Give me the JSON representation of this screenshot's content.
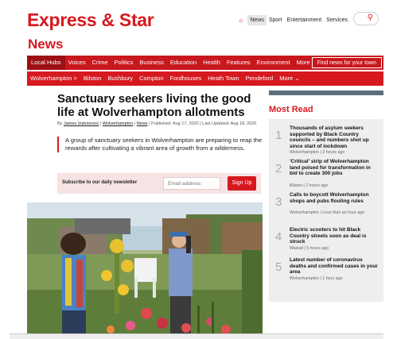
{
  "logo": "Express & Star",
  "topnav": {
    "items": [
      "News",
      "Sport",
      "Entertainment",
      "Services"
    ],
    "active": "News"
  },
  "section_title": "News",
  "rednav": {
    "items": [
      "Local Hubs",
      "Voices",
      "Crime",
      "Politics",
      "Business",
      "Education",
      "Health",
      "Features",
      "Environment",
      "More ⌄"
    ],
    "find_button": "Find news for your town"
  },
  "subnav": {
    "items": [
      "Wolverhampton >",
      "Bilston",
      "Bushbury",
      "Compton",
      "Fordhouses",
      "Heath Town",
      "Pendeford",
      "More ⌄"
    ]
  },
  "article": {
    "headline": "Sanctuary seekers living the good life at Wolverhampton allotments",
    "byline_prefix": "By ",
    "author": "James Vukmirovic",
    "sep1": " | ",
    "place": "Wolverhampton",
    "sep2": " | ",
    "category": "News",
    "dates": " | Published: Aug 17, 2020 | Last Updated: Aug 18, 2020",
    "standfirst": "A group of sanctuary seekers in Wolverhampton are preparing to reap the rewards after cultivating a vibrant area of growth from a wilderness."
  },
  "newsletter": {
    "label": "Subscribe to our daily newsletter",
    "placeholder": "Email address:",
    "button": "Sign Up"
  },
  "most_read": {
    "title": "Most Read",
    "items": [
      {
        "num": "1",
        "headline": "Thousands of asylum seekers supported by Black Country councils – and numbers shot up since start of lockdown",
        "meta": "Wolverhampton | 2 hours ago"
      },
      {
        "num": "2",
        "headline": "'Critical' strip of Wolverhampton land poised for transformation in bid to create 300 jobs",
        "meta": "Bilston | 2 hours ago"
      },
      {
        "num": "3",
        "headline": "Calls to boycott Wolverhampton shops and pubs flouting rules",
        "meta": "Wolverhampton | Less than an hour ago"
      },
      {
        "num": "4",
        "headline": "Electric scooters to hit Black Country streets soon as deal is struck",
        "meta": "Walsall | 5 hours ago"
      },
      {
        "num": "5",
        "headline": "Latest number of coronavirus deaths and confirmed cases in your area",
        "meta": "Wolverhampton | 1 hour ago"
      }
    ]
  },
  "colors": {
    "brand_red": "#d6191f",
    "nav_red": "#c8171d",
    "sidebar_bg": "#eeeeee"
  },
  "icons": [
    "home-icon",
    "search-icon"
  ]
}
